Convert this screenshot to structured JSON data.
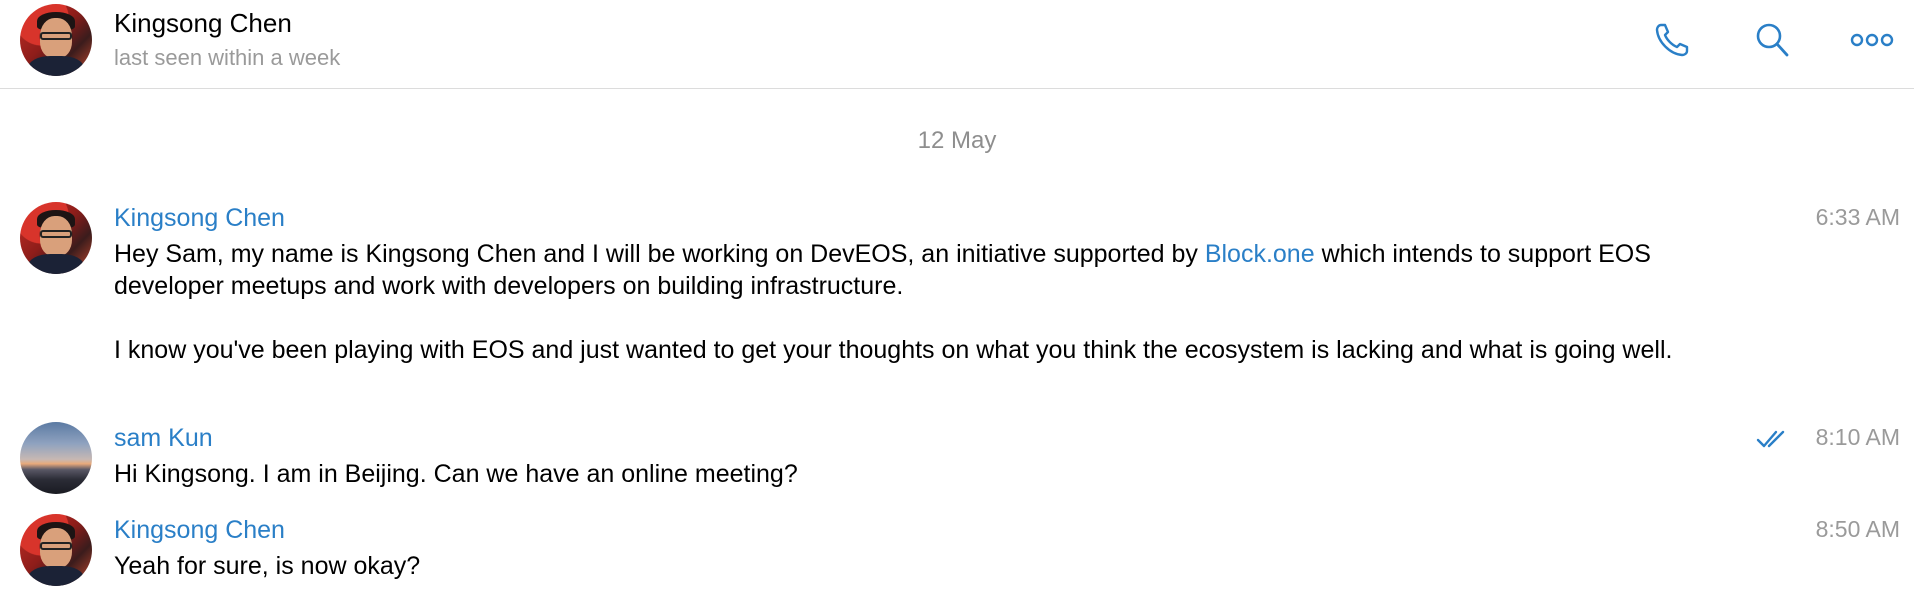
{
  "header": {
    "contact_name": "Kingsong Chen",
    "status": "last seen within a week",
    "icons": [
      "phone-icon",
      "search-icon",
      "more-icon"
    ]
  },
  "date_separator": "12 May",
  "messages": [
    {
      "sender": "Kingsong Chen",
      "time": "6:33 AM",
      "text_part1": "Hey Sam, my name is Kingsong Chen and I will be working on DevEOS, an initiative supported by ",
      "link": "Block.one",
      "text_part2": " which intends to support EOS developer meetups and work with developers on building infrastructure.",
      "paragraph2": "I know you've been playing with EOS and just wanted to get your thoughts on what you think the ecosystem is lacking and what is going well."
    },
    {
      "sender": "sam Kun",
      "time": "8:10 AM",
      "text": "Hi Kingsong. I am in Beijing. Can we have an online meeting?",
      "read_status": "double-check-icon"
    },
    {
      "sender": "Kingsong Chen",
      "time": "8:50 AM",
      "text": "Yeah for sure, is now okay?"
    }
  ],
  "colors": {
    "accent": "#2a7fc7",
    "muted": "#9a9a9a",
    "divider": "#dcdcdc"
  }
}
